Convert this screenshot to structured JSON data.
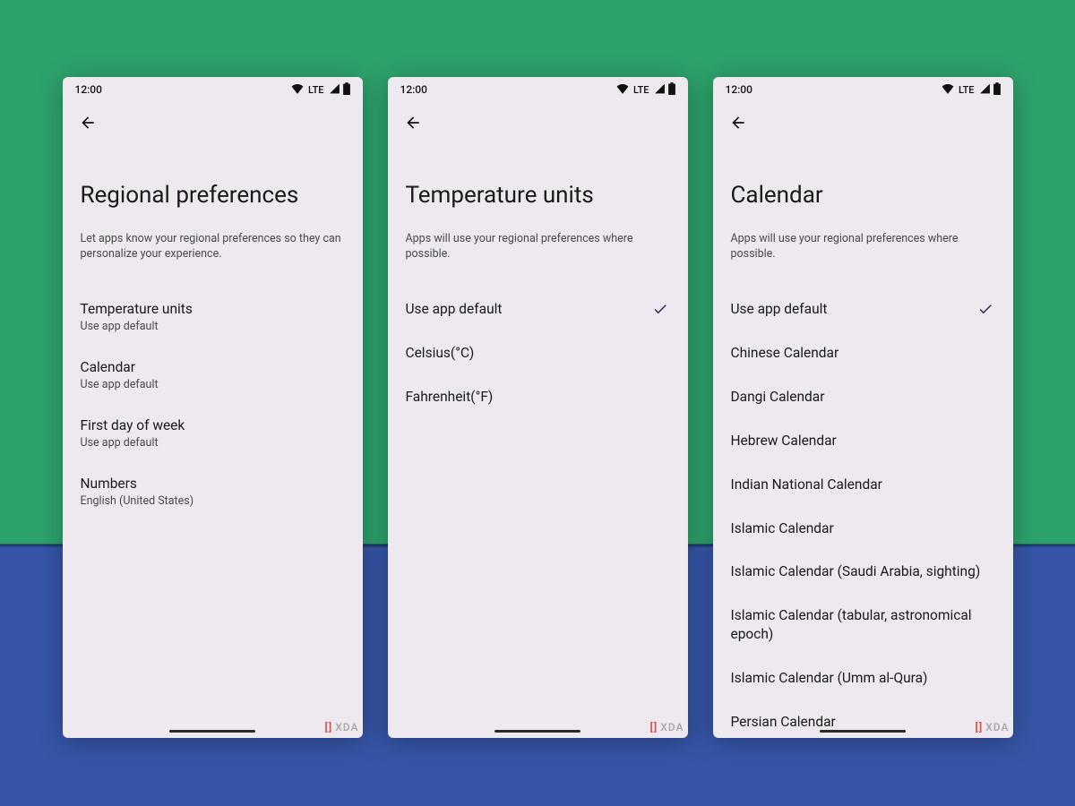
{
  "status": {
    "time": "12:00",
    "network": "LTE"
  },
  "screen1": {
    "title": "Regional preferences",
    "subtitle": "Let apps know your regional preferences so they can personalize your experience.",
    "items": [
      {
        "title": "Temperature units",
        "value": "Use app default"
      },
      {
        "title": "Calendar",
        "value": "Use app default"
      },
      {
        "title": "First day of week",
        "value": "Use app default"
      },
      {
        "title": "Numbers",
        "value": "English (United States)"
      }
    ]
  },
  "screen2": {
    "title": "Temperature units",
    "subtitle": "Apps will use your regional preferences where possible.",
    "options": [
      {
        "label": "Use app default",
        "selected": true
      },
      {
        "label": "Celsius(°C)",
        "selected": false
      },
      {
        "label": "Fahrenheit(°F)",
        "selected": false
      }
    ]
  },
  "screen3": {
    "title": "Calendar",
    "subtitle": "Apps will use your regional preferences where possible.",
    "options": [
      {
        "label": "Use app default",
        "selected": true
      },
      {
        "label": "Chinese Calendar",
        "selected": false
      },
      {
        "label": "Dangi Calendar",
        "selected": false
      },
      {
        "label": "Hebrew Calendar",
        "selected": false
      },
      {
        "label": "Indian National Calendar",
        "selected": false
      },
      {
        "label": "Islamic Calendar",
        "selected": false
      },
      {
        "label": "Islamic Calendar (Saudi Arabia, sighting)",
        "selected": false
      },
      {
        "label": "Islamic Calendar (tabular, astronomical epoch)",
        "selected": false
      },
      {
        "label": "Islamic Calendar (Umm al-Qura)",
        "selected": false
      },
      {
        "label": "Persian Calendar",
        "selected": false
      }
    ]
  },
  "watermark": {
    "bracket_left": "[",
    "bracket_right": "]",
    "text": "XDA"
  }
}
